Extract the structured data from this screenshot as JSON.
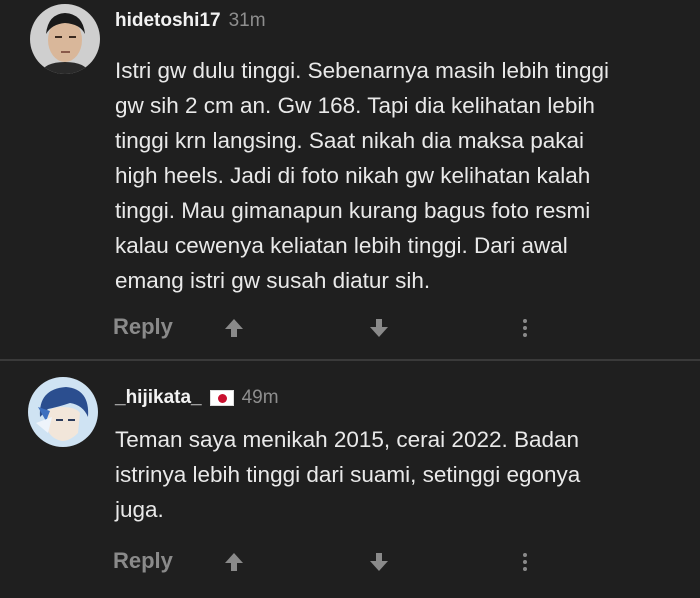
{
  "comments": [
    {
      "username": "hidetoshi17",
      "time": "31m",
      "text": "Istri gw dulu tinggi. Sebenarnya masih lebih tinggi\ngw sih 2 cm an. Gw 168. Tapi dia kelihatan lebih\ntinggi krn langsing. Saat nikah dia maksa pakai\nhigh heels. Jadi di foto nikah gw kelihatan kalah\ntinggi. Mau gimanapun kurang bagus foto resmi\nkalau cewenya keliatan lebih tinggi. Dari awal\nemang istri gw susah diatur sih.",
      "reply_label": "Reply"
    },
    {
      "username": "_hijikata_",
      "flag_icon": "japan-flag-icon",
      "time": "49m",
      "text": "Teman saya menikah 2015, cerai 2022. Badan\nistrinya lebih tinggi dari suami, setinggi egonya\njuga.",
      "reply_label": "Reply"
    }
  ],
  "icons": {
    "upvote": "arrow-up-icon",
    "downvote": "arrow-down-icon",
    "more": "more-vertical-icon"
  },
  "colors": {
    "background": "#1f1f1f",
    "text": "#e9e9e9",
    "muted": "#8a8a8a",
    "flag_red": "#c9102f"
  }
}
